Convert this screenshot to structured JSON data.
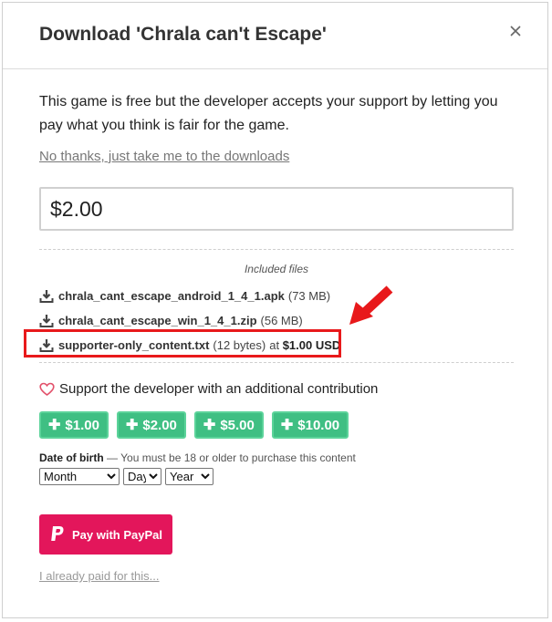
{
  "modal": {
    "title": "Download 'Chrala can't Escape'",
    "intro": "This game is free but the developer accepts your support by letting you pay what you think is fair for the game.",
    "skip_link": "No thanks, just take me to the downloads",
    "price_value": "$2.00"
  },
  "files": {
    "heading": "Included files",
    "items": [
      {
        "name": "chrala_cant_escape_android_1_4_1.apk",
        "size": "(73 MB)"
      },
      {
        "name": "chrala_cant_escape_win_1_4_1.zip",
        "size": "(56 MB)"
      },
      {
        "name": "supporter-only_content.txt",
        "size": "(12 bytes)",
        "price_prefix": "at",
        "price": "$1.00 USD"
      }
    ]
  },
  "support": {
    "text": "Support the developer with an additional contribution",
    "tips": [
      "$1.00",
      "$2.00",
      "$5.00",
      "$10.00"
    ]
  },
  "dob": {
    "label": "Date of birth",
    "note": "— You must be 18 or older to purchase this content",
    "month": "Month",
    "day": "Day",
    "year": "Year"
  },
  "paypal": {
    "label": "Pay with PayPal"
  },
  "paid_link": "I already paid for this...",
  "colors": {
    "accent_green": "#3fbf83",
    "paypal_pink": "#e3165b",
    "annotation_red": "#e8191b",
    "heart": "#e2506a"
  },
  "icons": {
    "close": "close-icon",
    "download": "download-icon",
    "heart": "heart-icon",
    "paypal": "paypal-icon",
    "arrow": "red-arrow-annotation"
  }
}
